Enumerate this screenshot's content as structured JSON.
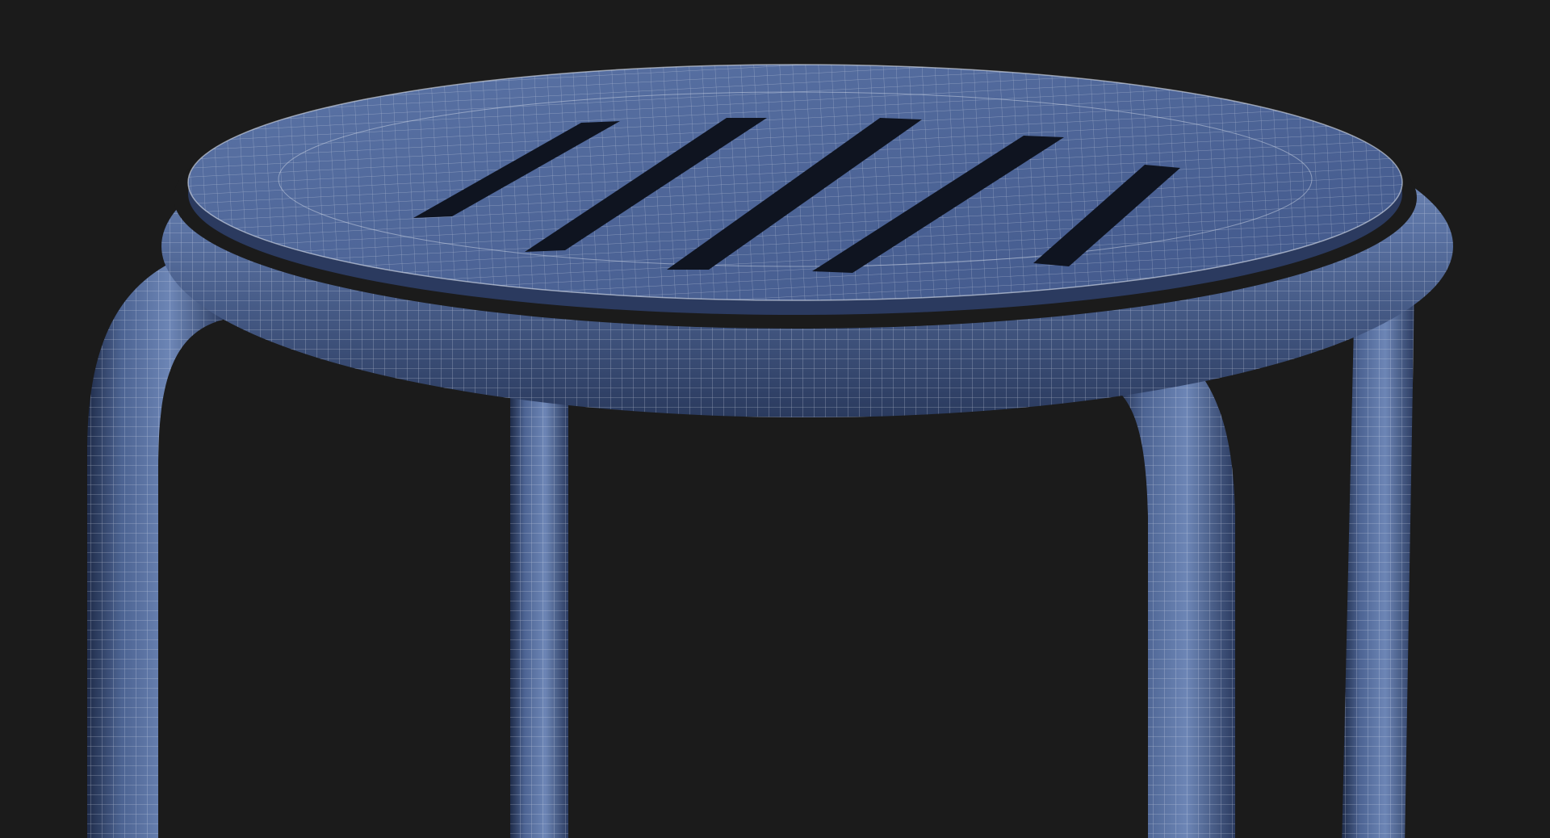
{
  "render": {
    "background_color": "#1b1b1b",
    "mesh_base_color": "#4d6493",
    "mesh_shadow_color": "#1f2c4a",
    "mesh_highlight_color": "#8fa5cc",
    "wire_color": "#dde4f0",
    "seat_slot_count": 5,
    "leg_count": 4,
    "subject_icon": "stool-wireframe-icon"
  }
}
